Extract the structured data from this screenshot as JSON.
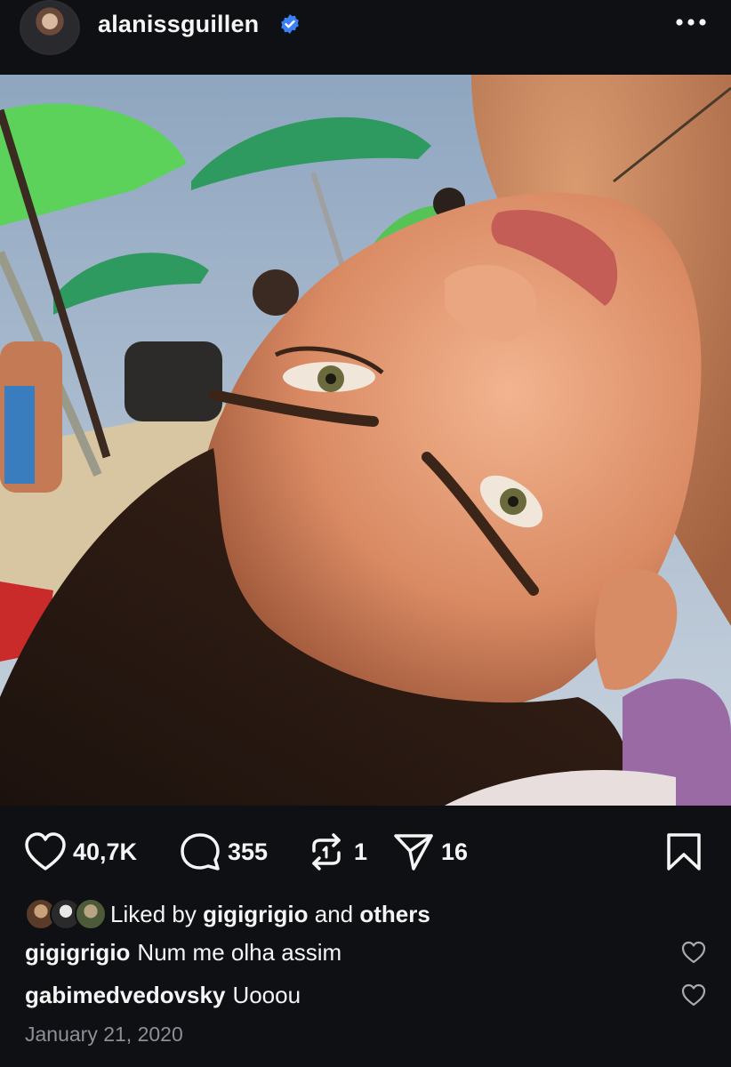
{
  "post": {
    "username": "alanissguillen",
    "verified": true,
    "more_icon": "more-horizontal-icon"
  },
  "actions": {
    "likes": "40,7K",
    "comments": "355",
    "reposts": "1",
    "shares": "16"
  },
  "liked_by": {
    "prefix": "Liked by",
    "user": "gigigrigio",
    "connector": "and",
    "suffix": "others"
  },
  "comments": [
    {
      "user": "gigigrigio",
      "text": "Num me olha assim"
    },
    {
      "user": "gabimedvedovsky",
      "text": "Uooou"
    }
  ],
  "date": "January 21, 2020",
  "colors": {
    "background": "#0e1014",
    "text": "#f5f5f5",
    "muted": "#8c8f96",
    "verified": "#3b82f6"
  }
}
